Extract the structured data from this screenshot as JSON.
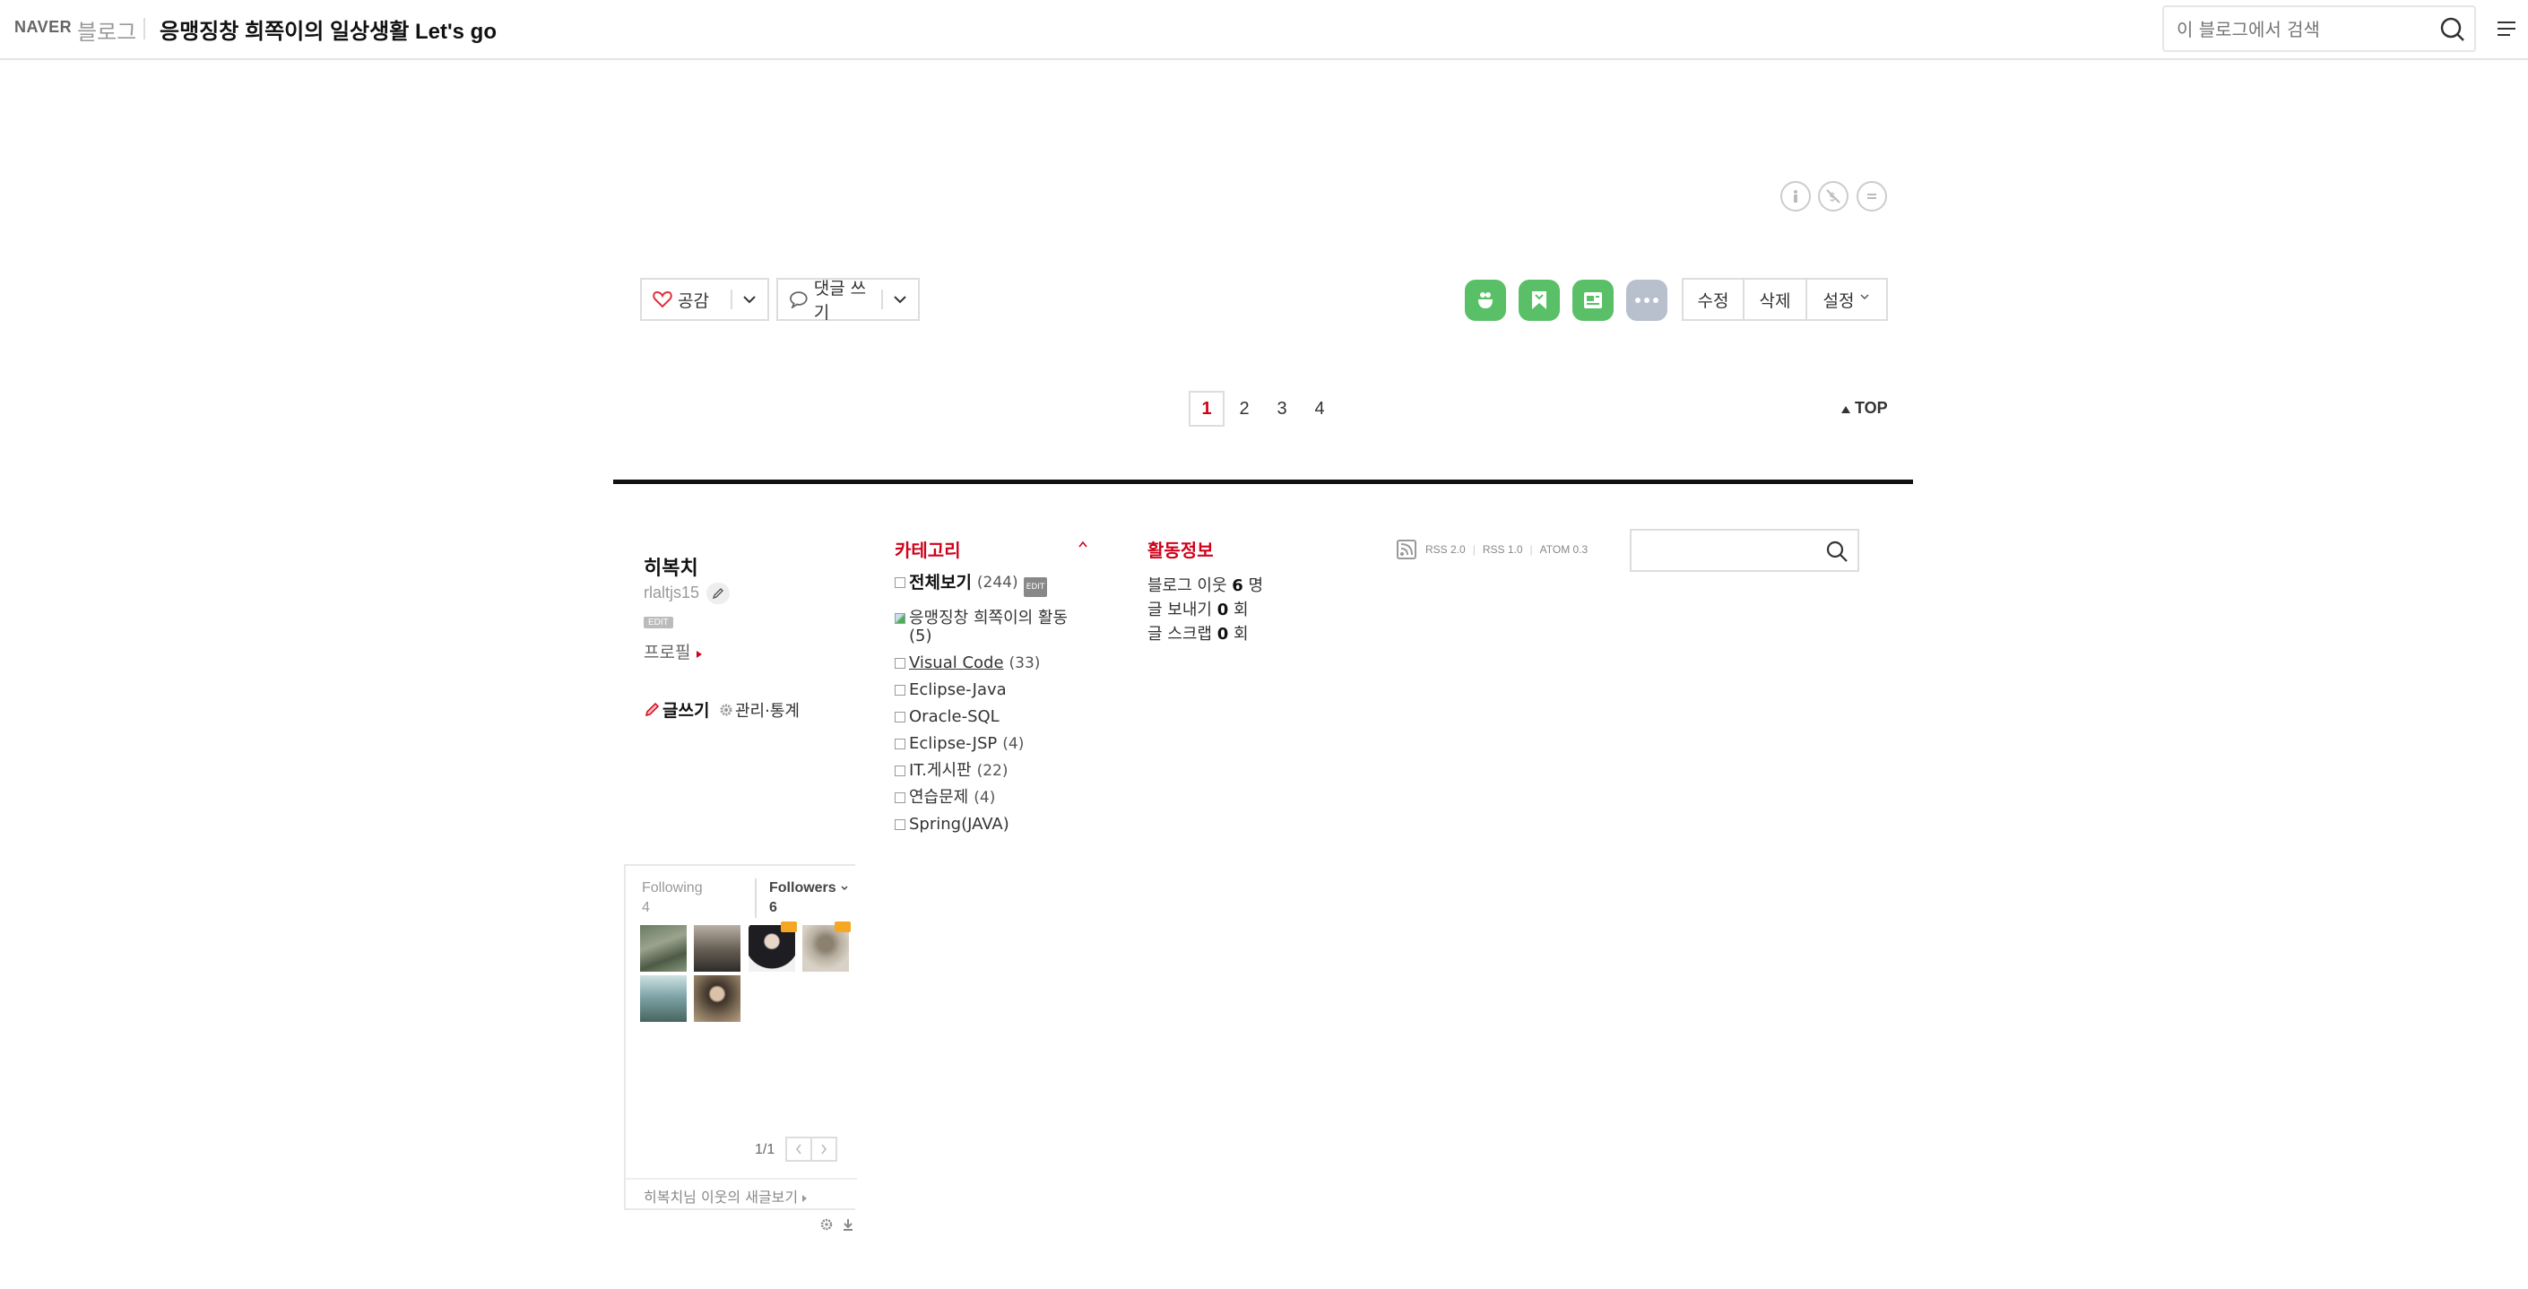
{
  "header": {
    "brand_naver": "NAVER",
    "brand_blog": "블로그",
    "blog_title": "응맹징창 희쪽이의 일상생활 Let's go",
    "search_placeholder": "이 블로그에서 검색"
  },
  "post_actions": {
    "like_label": "공감",
    "comment_label": "댓글 쓰기",
    "edit_buttons": [
      "수정",
      "삭제",
      "설정"
    ]
  },
  "pagination": {
    "pages": [
      "1",
      "2",
      "3",
      "4"
    ],
    "current": "1",
    "top_label": "TOP"
  },
  "profile": {
    "nickname": "히복치",
    "user_id": "rlaltjs15",
    "edit_tag": "EDIT",
    "profile_link": "프로필",
    "write_link": "글쓰기",
    "admin_link": "관리·통계"
  },
  "category": {
    "title": "카테고리",
    "items": [
      {
        "label": "전체보기",
        "count": "(244)",
        "edit": "EDIT"
      },
      {
        "label": "응맹징창 희쪽이의 활동",
        "count": "(5)"
      },
      {
        "label": "Visual Code",
        "count": "(33)"
      },
      {
        "label": "Eclipse-Java",
        "count": ""
      },
      {
        "label": "Oracle-SQL",
        "count": ""
      },
      {
        "label": "Eclipse-JSP",
        "count": "(4)"
      },
      {
        "label": "IT.게시판",
        "count": "(22)"
      },
      {
        "label": "연습문제",
        "count": "(4)"
      },
      {
        "label": "Spring(JAVA)",
        "count": ""
      }
    ]
  },
  "activity": {
    "title": "활동정보",
    "neighbors_prefix": "블로그 이웃",
    "neighbors_value": "6",
    "neighbors_unit": "명",
    "export_prefix": "글 보내기",
    "export_value": "0",
    "export_unit": "회",
    "scrap_prefix": "글 스크랩",
    "scrap_value": "0",
    "scrap_unit": "회"
  },
  "rss": {
    "links": [
      "RSS 2.0",
      "RSS 1.0",
      "ATOM 0.3"
    ]
  },
  "followers_widget": {
    "following_label": "Following",
    "following_count": "4",
    "followers_label": "Followers",
    "followers_count": "6",
    "page_indicator": "1/1",
    "new_posts_name": "히복치",
    "new_posts_suffix": "님 이웃의 새글보기"
  },
  "colors": {
    "accent_red": "#d0021b",
    "share_green": "#5ac068",
    "share_gray": "#b8bfcd"
  }
}
